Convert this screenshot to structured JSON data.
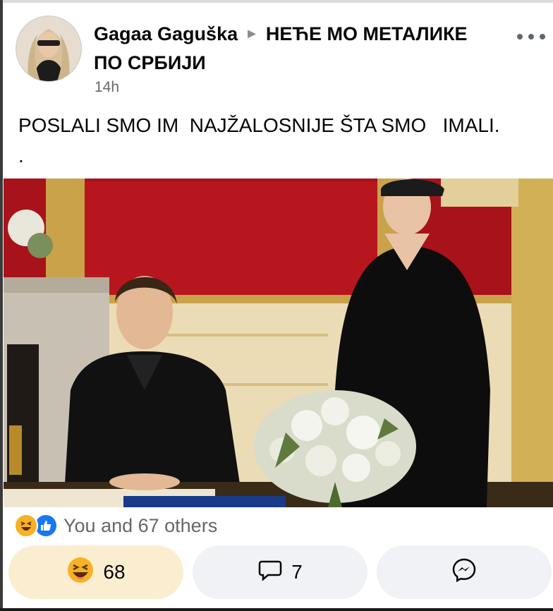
{
  "post": {
    "author": "Gagaa Gaguška",
    "group": "НЕЋЕ МО МЕТАЛИКЕ ПО СРБИЈИ",
    "timestamp": "14h",
    "text": "POSLALI SMO IM  NAJŽALOSNIJE ŠTA SMO   IMALI.",
    "text_trailing": "."
  },
  "reactions": {
    "summary": "You and 67 others",
    "icons": [
      "haha-icon",
      "like-icon"
    ]
  },
  "actions": {
    "react_count": "68",
    "comment_count": "7",
    "react_icon": "haha-icon",
    "comment_icon": "comment-bubble-icon",
    "share_icon": "messenger-icon"
  },
  "colors": {
    "like_blue": "#1877f2",
    "haha_yellow": "#f7b125",
    "react_button_bg": "#fbeed0",
    "button_bg": "#f0f2f5",
    "meta_gray": "#65676b"
  }
}
